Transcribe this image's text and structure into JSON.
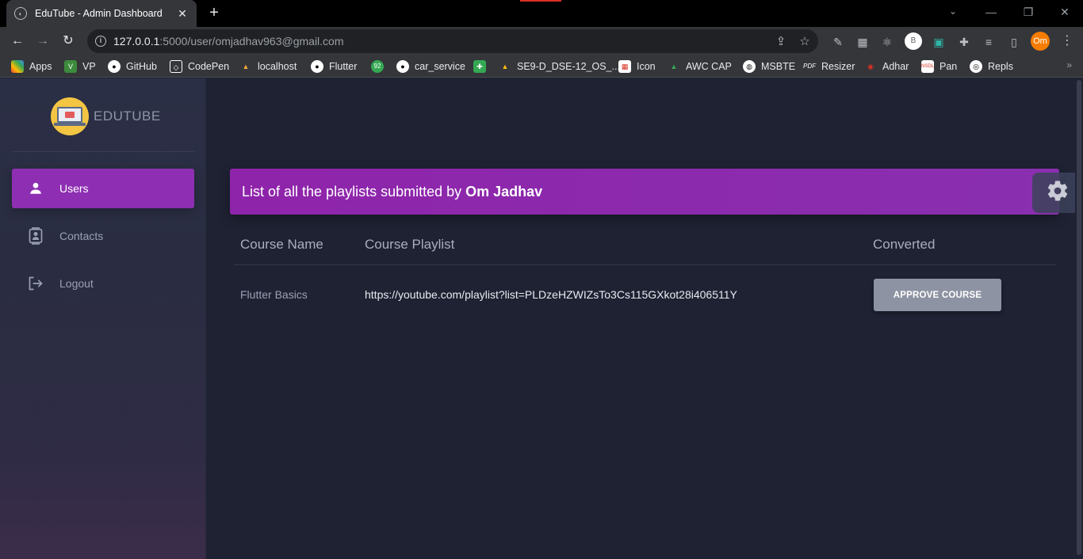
{
  "browser": {
    "tab_title": "EduTube - Admin Dashboard",
    "new_tab": "+",
    "url_host": "127.0.0.1",
    "url_path": ":5000/user/omjadhav963@gmail.com",
    "profile_initials": "Om",
    "extension_b": "B",
    "bookmarks": [
      "Apps",
      "VP",
      "GitHub",
      "CodePen",
      "localhost",
      "Flutter",
      "92",
      "car_service",
      "SE9-D_DSE-12_OS_...",
      "Icon",
      "AWC CAP",
      "MSBTE",
      "Resizer",
      "Adhar",
      "Pan",
      "Repls"
    ]
  },
  "sidebar": {
    "brand": "EDUTUBE",
    "items": [
      {
        "label": "Users",
        "icon": "person-icon",
        "active": true
      },
      {
        "label": "Contacts",
        "icon": "contacts-icon",
        "active": false
      },
      {
        "label": "Logout",
        "icon": "logout-icon",
        "active": false
      }
    ]
  },
  "main": {
    "title_prefix": "List of all the playlists submitted by ",
    "title_user": "Om Jadhav",
    "columns": [
      "Course Name",
      "Course Playlist",
      "Converted"
    ],
    "rows": [
      {
        "course_name": "Flutter Basics",
        "playlist": "https://youtube.com/playlist?list=PLDzeHZWIZsTo3Cs115GXkot28i406511Y",
        "action": "APPROVE COURSE"
      }
    ]
  },
  "colors": {
    "accent": "#8e24aa",
    "background": "#1f2233",
    "button": "#8e93a3"
  }
}
